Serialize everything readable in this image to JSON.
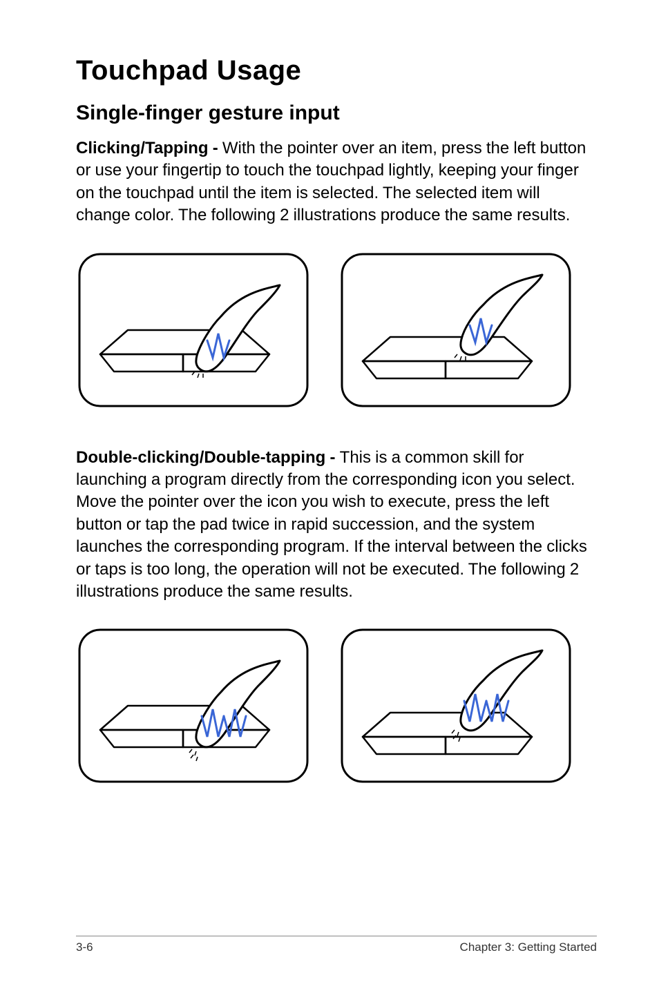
{
  "title": "Touchpad Usage",
  "section": "Single-finger gesture input",
  "para1_lead": "Clicking/Tapping - ",
  "para1_body": "With the pointer over an item, press the left button or use your fingertip to touch the touchpad lightly, keeping your finger on the touchpad until the item is selected. The selected item will change color. The following 2 illustrations produce the same results.",
  "para2_lead": "Double-clicking/Double-tapping - ",
  "para2_body": "This is a common skill for launching a program directly from the corresponding icon you select. Move the pointer over the icon you wish to execute, press the left button or tap the pad twice in rapid succession, and the system launches the corresponding program. If the interval between the clicks or taps is too long, the operation will not be executed. The following 2 illustrations produce the same results.",
  "footer_left": "3-6",
  "footer_right": "Chapter 3: Getting Started"
}
